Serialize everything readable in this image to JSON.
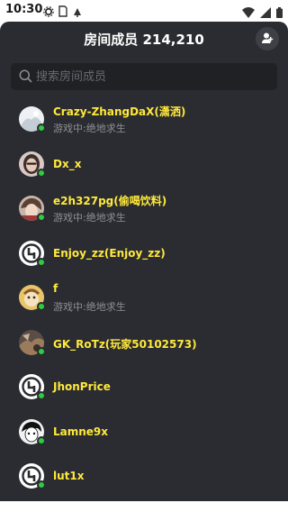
{
  "status_bar": {
    "time": "10:30",
    "left_icons": [
      "settings-icon",
      "sim-card-icon",
      "android-notify-icon"
    ],
    "right_icons": [
      "wifi-icon",
      "signal-icon",
      "battery-icon"
    ]
  },
  "header": {
    "title": "房间成员 214,210",
    "action_icon": "person-add-icon"
  },
  "search": {
    "placeholder": "搜索房间成员"
  },
  "members": [
    {
      "name": "Crazy-ZhangDaX(潇洒)",
      "status": "游戏中:绝地求生",
      "avatar": "avatar-photo-white"
    },
    {
      "name": "Dx_x",
      "status": "",
      "avatar": "avatar-photo-portrait"
    },
    {
      "name": "e2h327pg(偷喝饮料)",
      "status": "游戏中:绝地求生",
      "avatar": "avatar-photo-anime"
    },
    {
      "name": "Enjoy_zz(Enjoy_zz)",
      "status": "",
      "avatar": "avatar-default-logo"
    },
    {
      "name": "f",
      "status": "游戏中:绝地求生",
      "avatar": "avatar-photo-cartoon"
    },
    {
      "name": "GK_RoTz(玩家50102573)",
      "status": "",
      "avatar": "avatar-photo-dark"
    },
    {
      "name": "JhonPrice",
      "status": "",
      "avatar": "avatar-default-logo"
    },
    {
      "name": "Lamne9x",
      "status": "",
      "avatar": "avatar-photo-sketch"
    },
    {
      "name": "lut1x",
      "status": "",
      "avatar": "avatar-default-logo"
    }
  ],
  "colors": {
    "panel_bg": "#2a2c31",
    "name_color": "#ffe93b",
    "online_dot": "#2ecc40",
    "sub_text": "#8e9096"
  }
}
